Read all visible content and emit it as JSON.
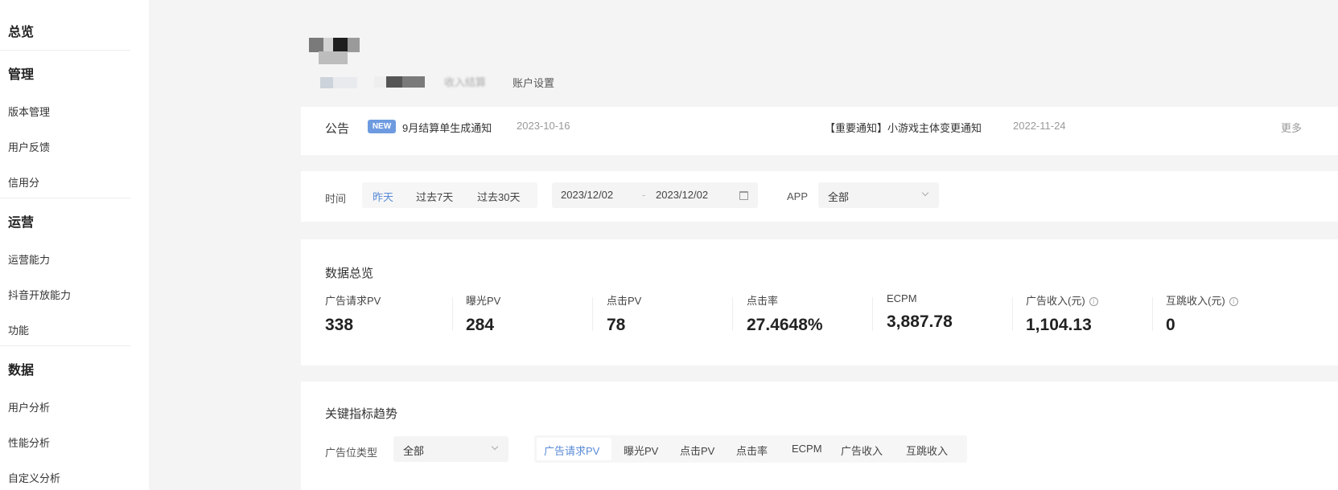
{
  "sidebar": {
    "overview": "总览",
    "manage": {
      "title": "管理",
      "items": [
        "版本管理",
        "用户反馈",
        "信用分"
      ]
    },
    "ops": {
      "title": "运营",
      "items": [
        "运营能力",
        "抖音开放能力",
        "功能"
      ]
    },
    "data": {
      "title": "数据",
      "items": [
        "用户分析",
        "性能分析",
        "自定义分析"
      ]
    }
  },
  "header": {
    "faded_tab": "收入结算",
    "settings_tab": "账户设置"
  },
  "notice": {
    "label": "公告",
    "badge": "NEW",
    "item1": {
      "title": "9月结算单生成通知",
      "date": "2023-10-16"
    },
    "item2": {
      "title": "【重要通知】小游戏主体变更通知",
      "date": "2022-11-24"
    },
    "more": "更多"
  },
  "filter": {
    "time_label": "时间",
    "presets": [
      "昨天",
      "过去7天",
      "过去30天"
    ],
    "active_preset": "昨天",
    "start_date": "2023/12/02",
    "date_sep": "-",
    "end_date": "2023/12/02",
    "app_label": "APP",
    "app_value": "全部"
  },
  "overview": {
    "title": "数据总览",
    "metrics": [
      {
        "label": "广告请求PV",
        "value": "338"
      },
      {
        "label": "曝光PV",
        "value": "284"
      },
      {
        "label": "点击PV",
        "value": "78"
      },
      {
        "label": "点击率",
        "value": "27.4648%"
      },
      {
        "label": "ECPM",
        "value": "3,887.78"
      },
      {
        "label": "广告收入(元)",
        "value": "1,104.13"
      },
      {
        "label": "互跳收入(元)",
        "value": "0"
      }
    ]
  },
  "trend": {
    "title": "关键指标趋势",
    "ad_type_label": "广告位类型",
    "ad_type_value": "全部",
    "tabs": [
      "广告请求PV",
      "曝光PV",
      "点击PV",
      "点击率",
      "ECPM",
      "广告收入",
      "互跳收入"
    ],
    "active_tab": "广告请求PV"
  },
  "colors": {
    "accent": "#5a8bd6",
    "badge": "#6e9be0",
    "background": "#f4f4f4"
  }
}
